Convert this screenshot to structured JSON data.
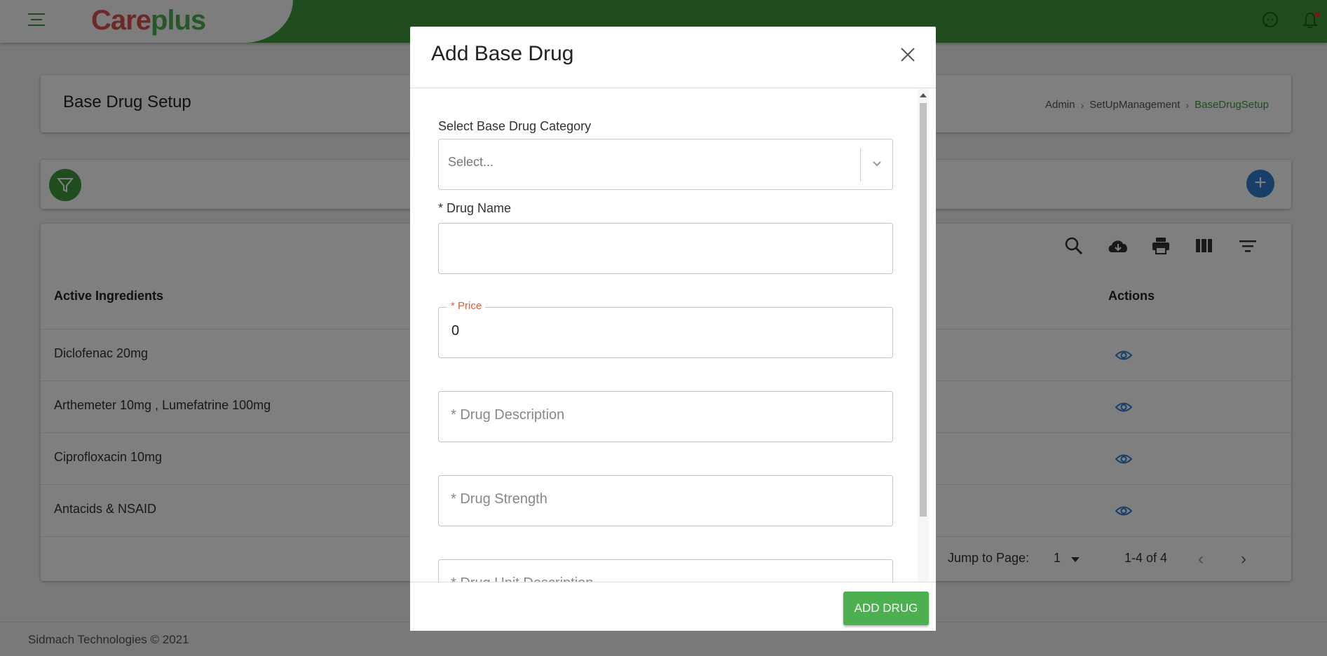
{
  "header": {
    "logo_part1": "Care",
    "logo_part2": "plus"
  },
  "page": {
    "title": "Base Drug Setup",
    "breadcrumb": [
      "Admin",
      "SetUpManagement",
      "BaseDrugSetup"
    ]
  },
  "table": {
    "columns": [
      "Active Ingredients",
      "Actions"
    ],
    "rows": [
      {
        "active_ingredients": "Diclofenac 20mg"
      },
      {
        "active_ingredients": "Arthemeter 10mg , Lumefatrine 100mg"
      },
      {
        "active_ingredients": "Ciprofloxacin 10mg"
      },
      {
        "active_ingredients": "Antacids & NSAID"
      }
    ],
    "jump_to_page_label": "Jump to Page:",
    "page_value": "1",
    "range_text": "1-4 of 4"
  },
  "footer": {
    "copyright": "Sidmach Technologies © 2021"
  },
  "modal": {
    "title": "Add Base Drug",
    "category_label": "Select Base Drug Category",
    "category_placeholder": "Select...",
    "drug_name_label": "* Drug Name",
    "drug_name_value": "",
    "price_label": "* Price",
    "price_value": "0",
    "drug_description_placeholder": "* Drug Description",
    "drug_strength_placeholder": "* Drug Strength",
    "drug_unit_description_placeholder": "* Drug Unit Description",
    "submit_label": "ADD DRUG"
  },
  "colors": {
    "brand_green": "#3e9a3c",
    "button_green": "#4caf50",
    "accent_blue": "#2f7fd1",
    "required_label": "#e25c3c"
  }
}
